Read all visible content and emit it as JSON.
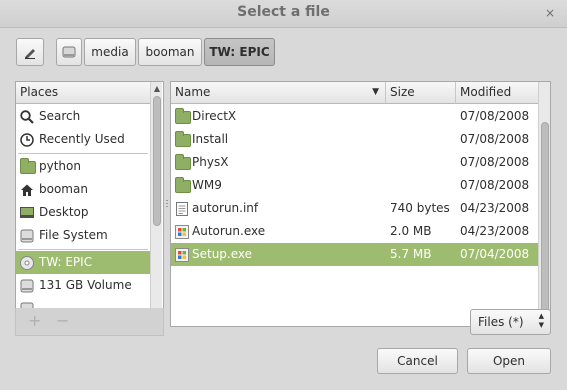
{
  "window": {
    "title": "Select a file",
    "close_glyph": "×"
  },
  "path_bar": {
    "edit_icon": "pencil-icon",
    "drive_icon": "drive-icon",
    "segments": [
      "media",
      "booman",
      "TW: EPIC"
    ],
    "active_segment": "TW: EPIC"
  },
  "places": {
    "header": "Places",
    "items": [
      {
        "label": "Search",
        "icon": "search-icon"
      },
      {
        "label": "Recently Used",
        "icon": "clock-icon"
      },
      {
        "label": "python",
        "icon": "folder-icon"
      },
      {
        "label": "booman",
        "icon": "home-icon"
      },
      {
        "label": "Desktop",
        "icon": "desktop-icon"
      },
      {
        "label": "File System",
        "icon": "drive-icon"
      },
      {
        "label": "TW: EPIC",
        "icon": "disc-icon",
        "selected": true
      },
      {
        "label": "131 GB Volume",
        "icon": "drive-icon"
      }
    ],
    "add_glyph": "+",
    "remove_glyph": "−"
  },
  "files": {
    "columns": {
      "name": "Name",
      "size": "Size",
      "modified": "Modified"
    },
    "rows": [
      {
        "name": "DirectX",
        "size": "",
        "modified": "07/08/2008",
        "icon": "folder-icon"
      },
      {
        "name": "Install",
        "size": "",
        "modified": "07/08/2008",
        "icon": "folder-icon"
      },
      {
        "name": "PhysX",
        "size": "",
        "modified": "07/08/2008",
        "icon": "folder-icon"
      },
      {
        "name": "WM9",
        "size": "",
        "modified": "07/08/2008",
        "icon": "folder-icon"
      },
      {
        "name": "autorun.inf",
        "size": "740 bytes",
        "modified": "04/23/2008",
        "icon": "text-file-icon"
      },
      {
        "name": "Autorun.exe",
        "size": "2.0 MB",
        "modified": "04/23/2008",
        "icon": "executable-icon"
      },
      {
        "name": "Setup.exe",
        "size": "5.7 MB",
        "modified": "07/04/2008",
        "icon": "executable-icon",
        "selected": true
      }
    ]
  },
  "filter": {
    "value": "Files (*)"
  },
  "actions": {
    "cancel_label": "Cancel",
    "open_label": "Open"
  },
  "colors": {
    "selection": "#9ebc70",
    "folder": "#8fb064"
  }
}
